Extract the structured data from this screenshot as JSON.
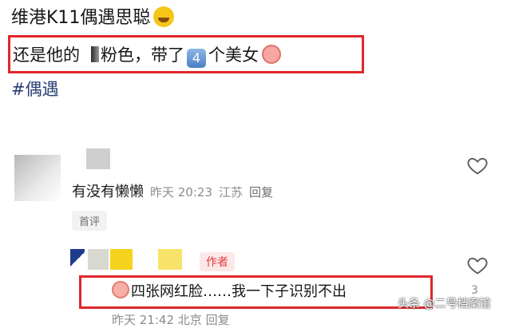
{
  "post": {
    "title": "维港K11偶遇思聪",
    "title_emoji": "rolling-laughing-emoji",
    "line_before": "还是他的",
    "line_mid": "粉色，带了",
    "keycap_number": "4",
    "line_after": "个美女",
    "line_emoji": "shy-face-emoji",
    "hashtag": "#偶遇"
  },
  "comment1": {
    "text": "有没有懒懒",
    "time": "昨天 20:23",
    "location": "江苏",
    "reply_label": "回复",
    "tag": "首评"
  },
  "comment2": {
    "badge": "作者",
    "text": "四张网红脸……我一下子识别不出",
    "like_count": "3",
    "time": "昨天 21:42",
    "location": "北京",
    "reply_label": "回复"
  },
  "watermark": "头条 @二号档案馆",
  "colors": {
    "highlight_box": "#e0262b",
    "hashtag": "#2a3f73",
    "author_badge": "#e03c3c"
  }
}
